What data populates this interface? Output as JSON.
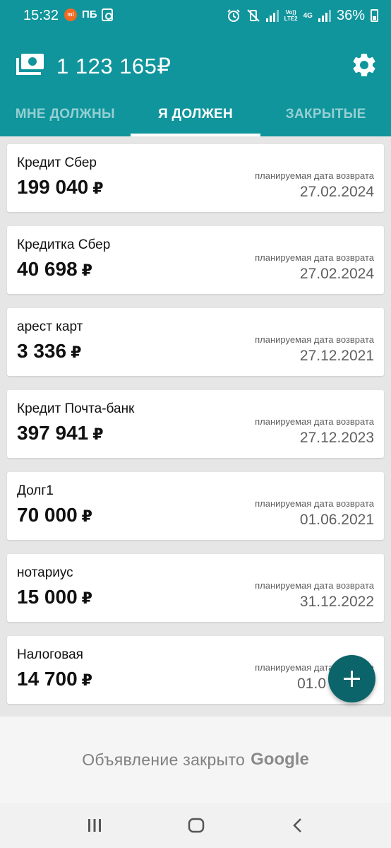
{
  "status_bar": {
    "time": "15:32",
    "mi_badge": "mi",
    "carrier_tag": "ПБ",
    "volte": "Vo))\nLTE2",
    "network": "4G",
    "battery": "36%"
  },
  "header": {
    "total": "1 123 165₽",
    "accent_color": "#10959c"
  },
  "tabs": [
    {
      "label": "МНЕ ДОЛЖНЫ",
      "active": false
    },
    {
      "label": "Я ДОЛЖЕН",
      "active": true
    },
    {
      "label": "ЗАКРЫТЫЕ",
      "active": false
    }
  ],
  "debts": [
    {
      "name": "Кредит Сбер",
      "amount": "199 040",
      "currency": "₽",
      "date_label": "планируемая дата возврата",
      "date": "27.02.2024"
    },
    {
      "name": "Кредитка Сбер",
      "amount": "40 698",
      "currency": "₽",
      "date_label": "планируемая дата возврата",
      "date": "27.02.2024"
    },
    {
      "name": "арест карт",
      "amount": "3 336",
      "currency": "₽",
      "date_label": "планируемая дата возврата",
      "date": "27.12.2021"
    },
    {
      "name": "Кредит Почта-банк",
      "amount": "397 941",
      "currency": "₽",
      "date_label": "планируемая дата возврата",
      "date": "27.12.2023"
    },
    {
      "name": "Долг1",
      "amount": "70 000",
      "currency": "₽",
      "date_label": "планируемая дата возврата",
      "date": "01.06.2021"
    },
    {
      "name": "нотариус",
      "amount": "15 000",
      "currency": "₽",
      "date_label": "планируемая дата возврата",
      "date": "31.12.2022"
    },
    {
      "name": "Налоговая",
      "amount": "14 700",
      "currency": "₽",
      "date_label": "планируемая дата возврата",
      "date": "01.0"
    }
  ],
  "ad": {
    "text": "Объявление закрыто",
    "brand": "Google"
  },
  "icons": {
    "money": "money-icon",
    "settings": "gear-icon",
    "add": "plus-icon",
    "nav_recents": "recents-icon",
    "nav_home": "home-icon",
    "nav_back": "back-icon"
  }
}
